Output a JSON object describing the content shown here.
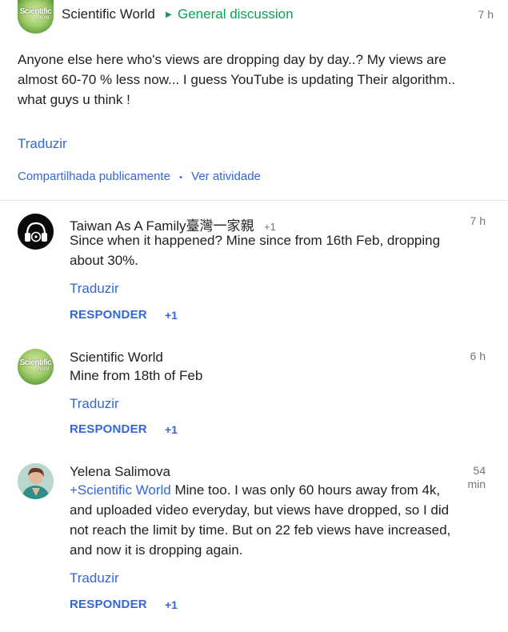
{
  "post": {
    "author": "Scientific World",
    "avatar_text_1": "Scientific",
    "avatar_text_2": "World",
    "community": "General discussion",
    "time": "7 h",
    "body": "Anyone else here who's views are dropping day by day..? My views are almost 60-70 % less now... I guess YouTube is updating Their algorithm.. what guys u think !",
    "translate": "Traduzir",
    "shared": "Compartilhada publicamente",
    "separator": "•",
    "activity": "Ver atividade"
  },
  "comments": [
    {
      "author": "Taiwan As A Family臺灣一家親",
      "plus_count": "+1",
      "time": "7 h",
      "body": "Since when it happened? Mine since from 16th Feb, dropping about 30%.",
      "translate": "Traduzir",
      "reply": "RESPONDER",
      "plus_one": "+1"
    },
    {
      "author": "Scientific World",
      "avatar_text_1": "Scientific",
      "avatar_text_2": "World",
      "time": "6 h",
      "body": "Mine from 18th of Feb",
      "translate": "Traduzir",
      "reply": "RESPONDER",
      "plus_one": "+1"
    },
    {
      "author": "Yelena Salimova",
      "time_line1": "54",
      "time_line2": "min",
      "mention": "+Scientific World",
      "body": " Mine too. I was only 60 hours away from 4k, and uploaded video everyday, but views  have dropped, so I did not reach the limit by time. But on 22 feb views have increased, and now it is dropping again.",
      "translate": "Traduzir",
      "reply": "RESPONDER",
      "plus_one": "+1"
    }
  ],
  "colors": {
    "link_blue": "#3367d6",
    "community_green": "#0f9d58",
    "meta_gray": "#757575",
    "text": "#212121"
  }
}
